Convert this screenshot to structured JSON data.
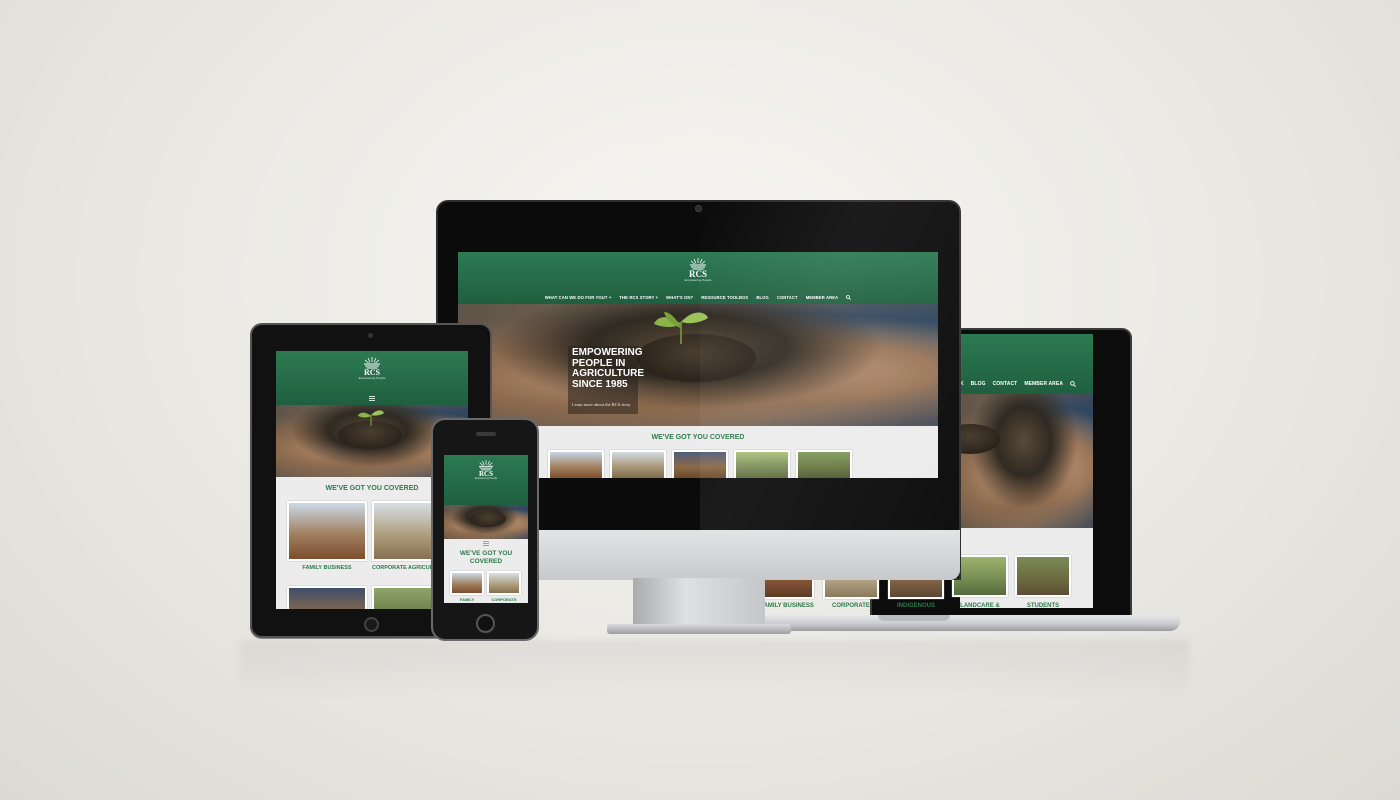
{
  "brand": {
    "logo_text": "RCS",
    "tagline": "Empowering People",
    "green": "#2c7a52",
    "dark_green": "#1f5f3f"
  },
  "nav": {
    "items": [
      "WHAT CAN WE DO FOR YOU? +",
      "THE RCS STORY +",
      "WHAT'S ON?",
      "RESOURCE TOOLBOX",
      "BLOG",
      "CONTACT",
      "MEMBER AREA"
    ],
    "search_icon": "search-icon",
    "menu_icon": "hamburger-icon"
  },
  "laptop_nav": {
    "items": [
      "K",
      "BLOG",
      "CONTACT",
      "MEMBER AREA"
    ]
  },
  "hero": {
    "headline_lines": [
      "EMPOWERING",
      "PEOPLE IN",
      "AGRICULTURE",
      "SINCE 1985"
    ],
    "link": "Learn more about the RCS story"
  },
  "covered": {
    "title": "WE'VE GOT YOU COVERED",
    "phone_title_lines": [
      "WE'VE GOT YOU",
      "COVERED"
    ],
    "categories": [
      "FAMILY BUSINESS",
      "CORPORATE AGRICULTURE",
      "INDIGENOUS",
      "LANDCARE &",
      "STUDENTS"
    ],
    "laptop_captions": [
      "FAMILY BUSINESS",
      "CORPORATE",
      "INDIGENOUS",
      "LANDCARE &",
      "STUDENTS"
    ],
    "tablet_captions": [
      "FAMILY BUSINESS",
      "CORPORATE AGRICUL"
    ],
    "phone_captions": [
      "FAMILY",
      "CORPORATE"
    ]
  }
}
